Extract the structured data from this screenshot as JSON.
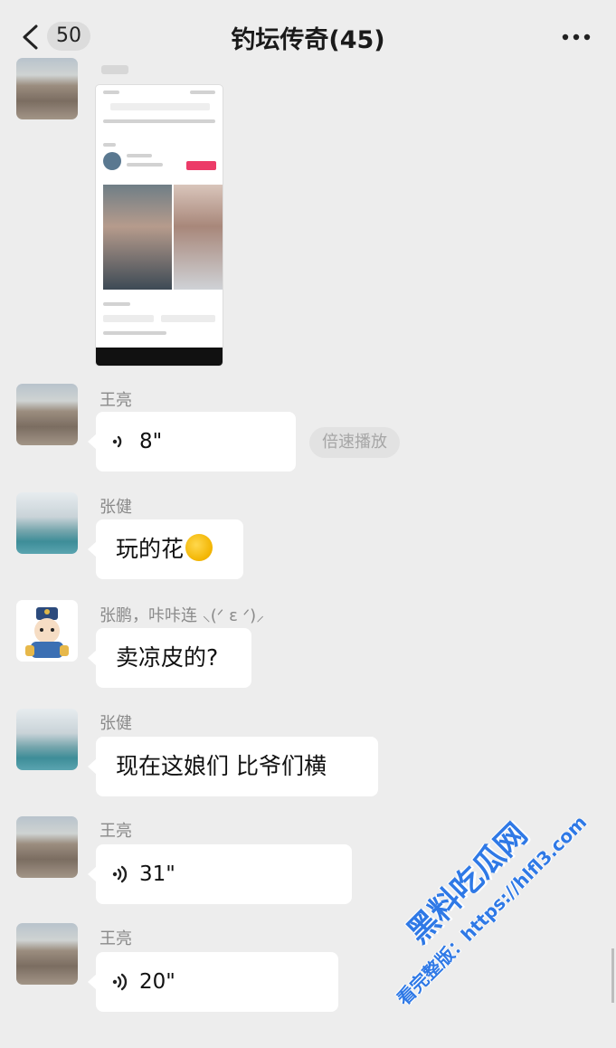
{
  "header": {
    "unread_count": "50",
    "title": "钓坛传奇(45)"
  },
  "messages": [
    {
      "sender": "王亮",
      "duration": "8\"",
      "speed_label": "倍速播放"
    },
    {
      "sender": "张健",
      "text": "玩的花"
    },
    {
      "sender": "张鹏，咔咔连 ⸜(ᐟ ε ᐟ)⸝",
      "text": "卖凉皮的?"
    },
    {
      "sender": "张健",
      "text": "现在这娘们 比爷们横"
    },
    {
      "sender": "王亮",
      "duration": "31\""
    },
    {
      "sender": "王亮",
      "duration": "20\""
    }
  ],
  "watermark": {
    "main": "黑料吃瓜网",
    "sub": "看完整版：https://hlfl3.com"
  },
  "colors": {
    "background": "#ededed",
    "bubble": "#ffffff",
    "watermark": "#2f79e6"
  },
  "icons": [
    "back-icon",
    "more-icon",
    "voice-icon",
    "emoji-icon"
  ]
}
